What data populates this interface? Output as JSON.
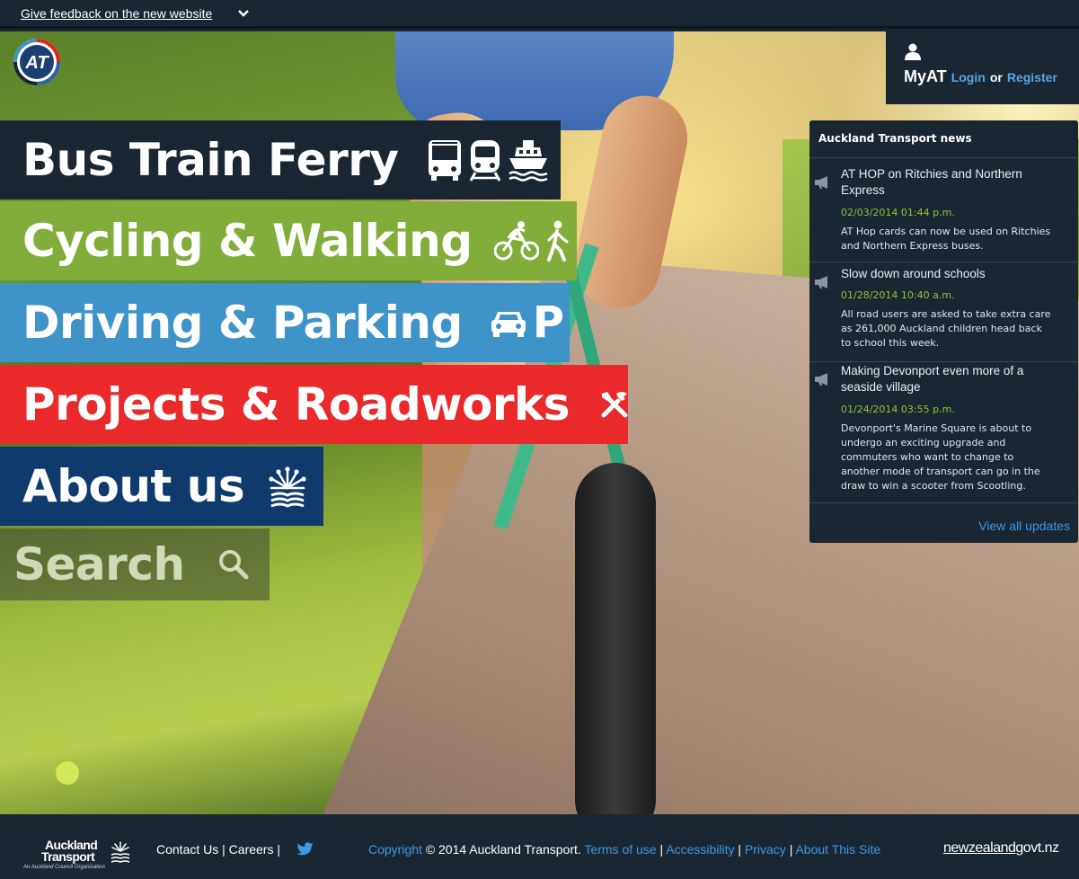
{
  "feedback": {
    "label": "Give feedback on the new website"
  },
  "myat": {
    "title": "MyAT",
    "login": "Login",
    "or": "or",
    "register": "Register"
  },
  "menu": {
    "bus": "Bus Train Ferry",
    "cycling": "Cycling & Walking",
    "driving": "Driving & Parking",
    "driving_p": "P",
    "projects": "Projects & Roadworks",
    "about": "About us",
    "search": "Search"
  },
  "news": {
    "title": "Auckland Transport news",
    "items": [
      {
        "headline": "AT HOP on Ritchies and Northern Express",
        "date": "02/03/2014 01:44 p.m.",
        "body": "AT Hop cards can now be used on Ritchies and Northern Express buses."
      },
      {
        "headline": "Slow down around schools",
        "date": "01/28/2014 10:40 a.m.",
        "body": "All road users are asked to take extra care as 261,000 Auckland children head back to school this week."
      },
      {
        "headline": "Making Devonport even more of a seaside village",
        "date": "01/24/2014 03:55 p.m.",
        "body": "Devonport's Marine Square is about to undergo an exciting upgrade and commuters who want to change to another mode of transport can go in the draw to win a scooter from Scootling."
      }
    ],
    "view_all": "View all updates"
  },
  "footer": {
    "brand_line1": "Auckland",
    "brand_line2": "Transport",
    "brand_tagline": "An Auckland Council Organisation",
    "contact": "Contact Us",
    "careers": "Careers",
    "sep": "|",
    "copyright_link": "Copyright",
    "copyright_text": "© 2014 Auckland Transport.",
    "terms": "Terms of use",
    "accessibility": "Accessibility",
    "privacy": "Privacy",
    "about_site": "About This Site",
    "nzgovt_a": "newzealand",
    "nzgovt_b": "govt.nz"
  },
  "colors": {
    "bus": "#1b2633",
    "cycling": "#82ad3b",
    "driving": "#3e93c9",
    "projects": "#ea2a2a",
    "about": "#0e3a6e",
    "link": "#3a9ae6",
    "news_date": "#8fc43a"
  }
}
